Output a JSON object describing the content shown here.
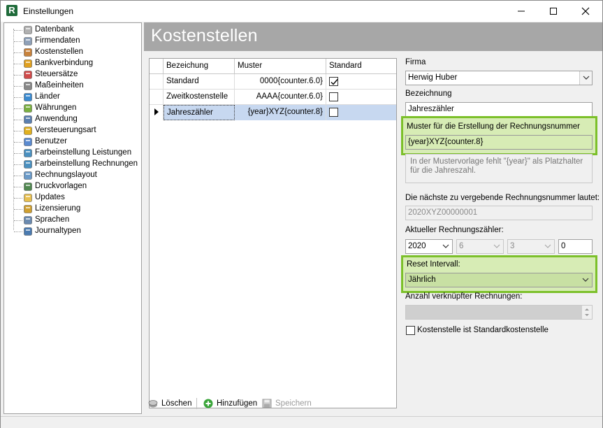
{
  "window": {
    "title": "Einstellungen"
  },
  "sidebar": {
    "items": [
      {
        "label": "Datenbank",
        "icon": "database-icon"
      },
      {
        "label": "Firmendaten",
        "icon": "building-icon"
      },
      {
        "label": "Kostenstellen",
        "icon": "house-icon"
      },
      {
        "label": "Bankverbindung",
        "icon": "euro-icon"
      },
      {
        "label": "Steuersätze",
        "icon": "pie-icon"
      },
      {
        "label": "Maßeinheiten",
        "icon": "ruler-icon"
      },
      {
        "label": "Länder",
        "icon": "globe-icon"
      },
      {
        "label": "Währungen",
        "icon": "money-icon"
      },
      {
        "label": "Anwendung",
        "icon": "app-icon"
      },
      {
        "label": "Versteuerungsart",
        "icon": "coins-icon"
      },
      {
        "label": "Benutzer",
        "icon": "users-icon"
      },
      {
        "label": "Farbeinstellung Leistungen",
        "icon": "palette-icon"
      },
      {
        "label": "Farbeinstellung Rechnungen",
        "icon": "palette-icon"
      },
      {
        "label": "Rechnungslayout",
        "icon": "layout-icon"
      },
      {
        "label": "Druckvorlagen",
        "icon": "print-template-icon"
      },
      {
        "label": "Updates",
        "icon": "folder-icon"
      },
      {
        "label": "Lizensierung",
        "icon": "key-icon"
      },
      {
        "label": "Sprachen",
        "icon": "chat-icon"
      },
      {
        "label": "Journaltypen",
        "icon": "book-icon"
      }
    ]
  },
  "main": {
    "title": "Kostenstellen",
    "grid": {
      "columns": [
        "Bezeichung",
        "Muster",
        "Standard"
      ],
      "rows": [
        {
          "name": "Standard",
          "pattern": "0000{counter.6.0}",
          "default": true
        },
        {
          "name": "Zweitkostenstelle",
          "pattern": "AAAA{counter.6.0}",
          "default": false
        },
        {
          "name": "Jahreszähler",
          "pattern": "{year}XYZ{counter.8}",
          "default": false
        }
      ]
    },
    "toolbar": {
      "delete_label": "Löschen",
      "add_label": "Hinzufügen",
      "save_label": "Speichern"
    }
  },
  "form": {
    "firma_label": "Firma",
    "firma_value": "Herwig Huber",
    "bezeichnung_label": "Bezeichnung",
    "bezeichnung_value": "Jahreszähler",
    "muster_label": "Muster für die Erstellung der Rechnungsnummer",
    "muster_value": "{year}XYZ{counter.8}",
    "hint_text": "In der Mustervorlage fehlt \"{year}\" als Platzhalter für die Jahreszahl.",
    "next_number_label": "Die nächste zu vergebende Rechnungsnummer lautet:",
    "next_number_value": "2020XYZ00000001",
    "counter_label": "Aktueller Rechnungszähler:",
    "counter_year": "2020",
    "counter_month": "6",
    "counter_day": "3",
    "counter_value": "0",
    "reset_label": "Reset Intervall:",
    "reset_value": "Jährlich",
    "linked_label": "Anzahl verknüpfter Rechnungen:",
    "default_checkbox_label": "Kostenstelle ist Standardkostenstelle",
    "default_checked": false,
    "highlight_color": "#7cc02a"
  }
}
